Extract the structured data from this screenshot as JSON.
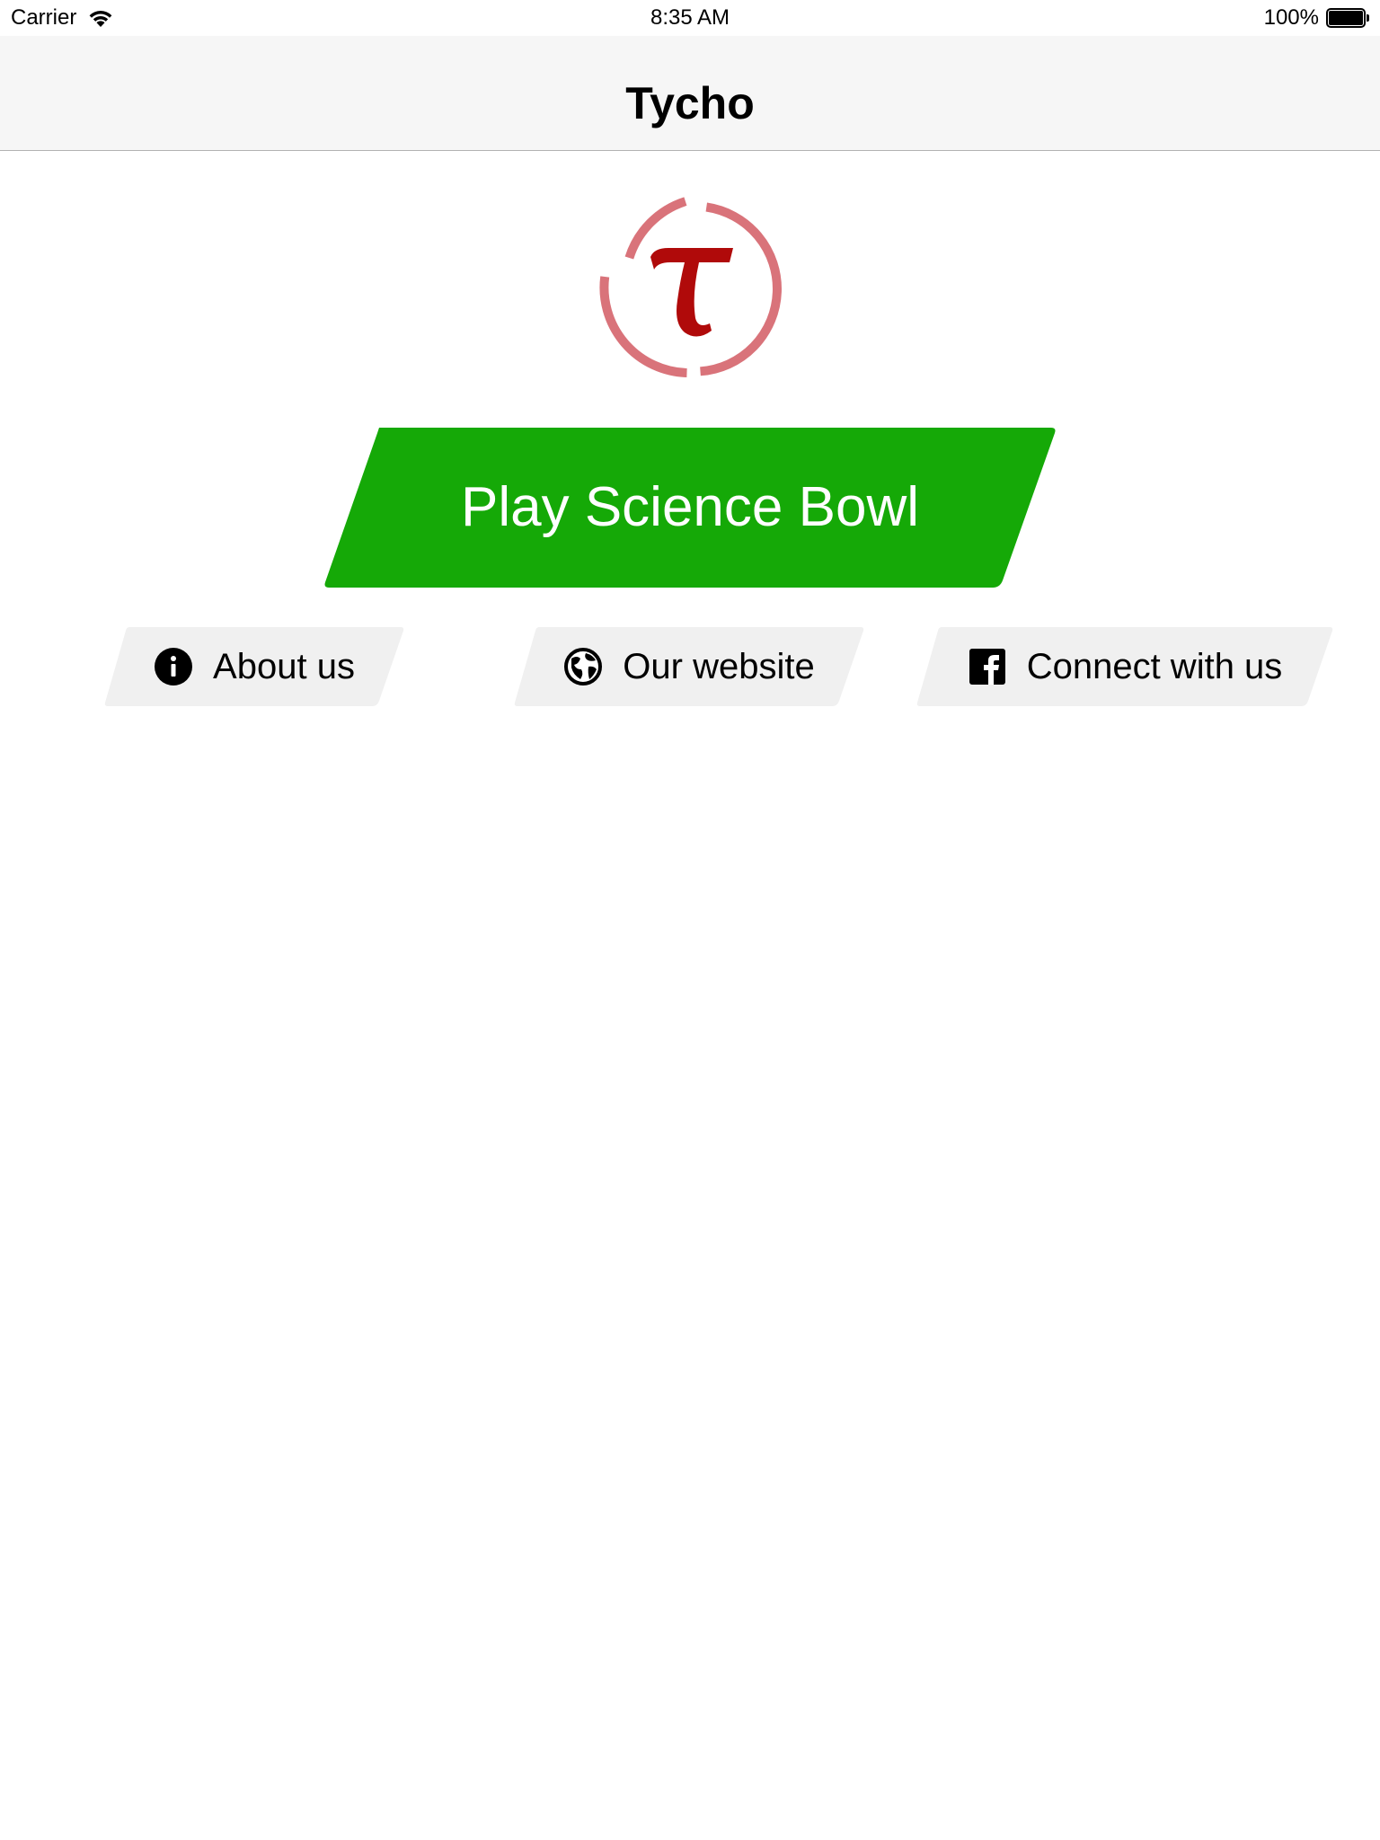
{
  "status_bar": {
    "carrier": "Carrier",
    "time": "8:35 AM",
    "battery": "100%",
    "battery_level": 1.0
  },
  "nav": {
    "title": "Tycho"
  },
  "logo": {
    "symbol": "τ",
    "ring_color": "#d9737a",
    "symbol_color": "#b00a0a"
  },
  "play_button": {
    "label": "Play Science Bowl",
    "color": "#15a907"
  },
  "links": [
    {
      "label": "About us",
      "icon": "info-icon"
    },
    {
      "label": "Our website",
      "icon": "globe-icon"
    },
    {
      "label": "Connect with us",
      "icon": "facebook-icon"
    }
  ],
  "colors": {
    "secondary_button_bg": "#f0f0f0",
    "nav_bg": "#f6f6f6"
  }
}
